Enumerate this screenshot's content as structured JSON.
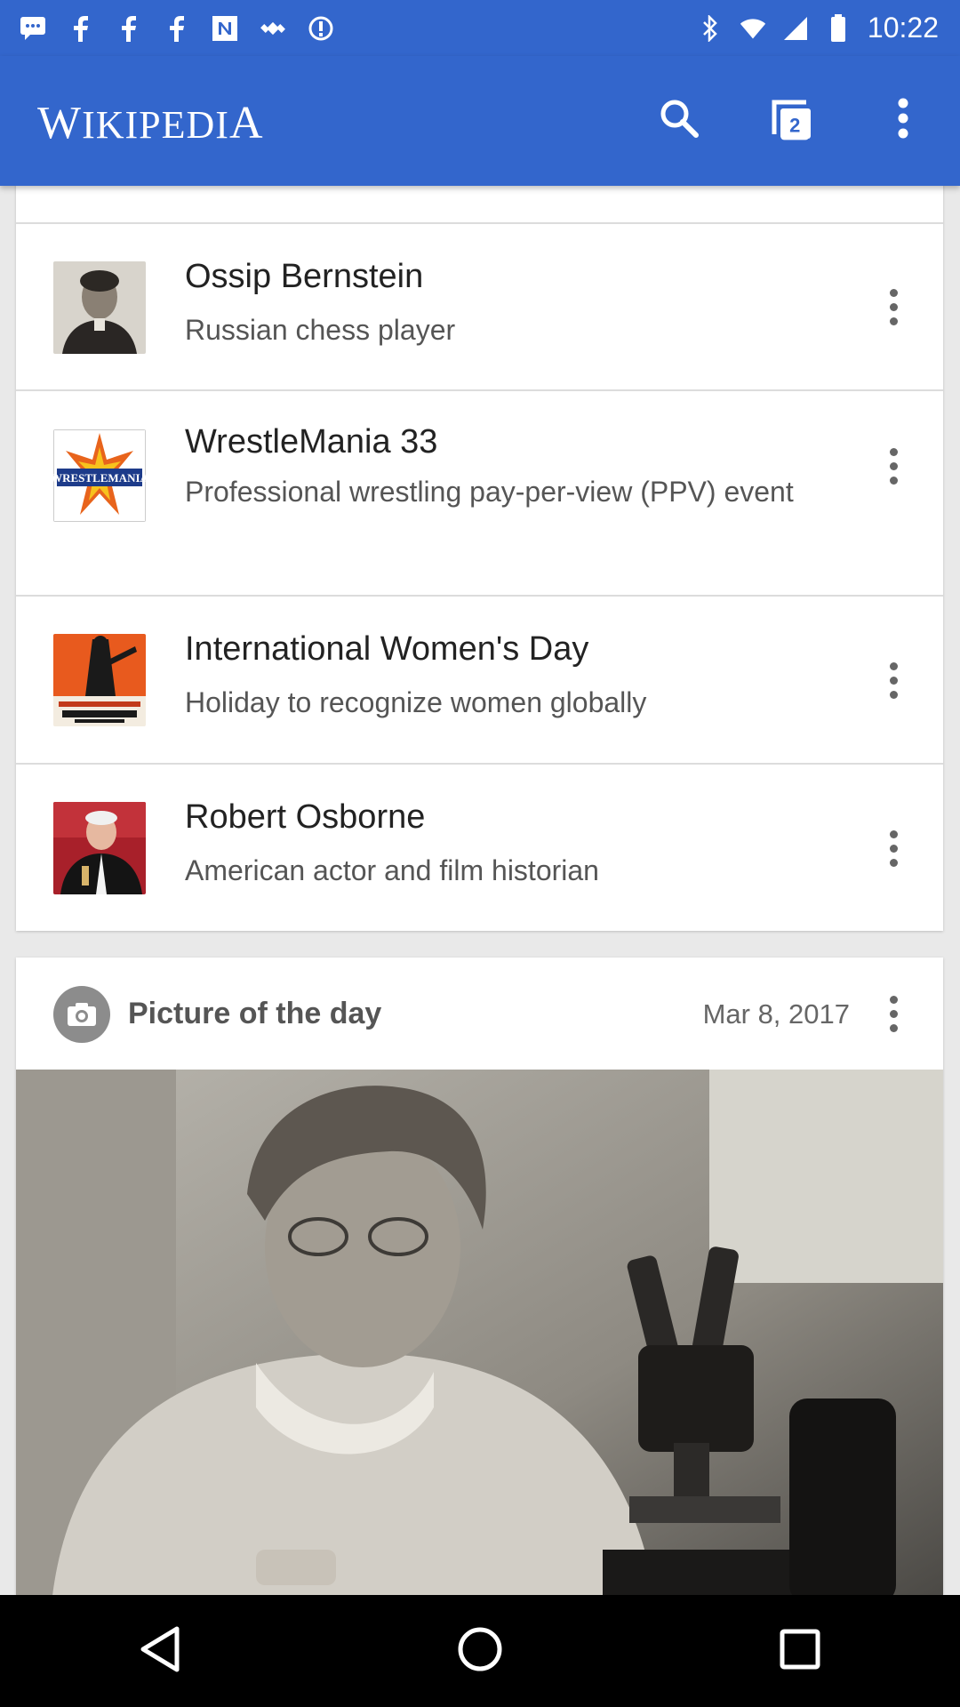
{
  "status_bar": {
    "time": "10:22",
    "icons": [
      "chat-icon",
      "facebook-icon",
      "facebook-icon",
      "facebook-icon",
      "news-icon",
      "gps-icon",
      "data-saver-icon",
      "bluetooth-icon",
      "wifi-icon",
      "cell-signal-icon",
      "battery-icon"
    ]
  },
  "app_bar": {
    "logo_first": "W",
    "logo_middle": "IKIPEDI",
    "logo_last": "A",
    "tab_count": "2",
    "icons": [
      "search-icon",
      "tabs-icon",
      "more-vertical-icon"
    ]
  },
  "feed_list": {
    "items": [
      {
        "title": "Ossip Bernstein",
        "description": "Russian chess player",
        "thumb": "portrait-photo"
      },
      {
        "title": "WrestleMania 33",
        "description": "Professional wrestling pay-per-view (PPV) event",
        "thumb": "wrestlemania-logo"
      },
      {
        "title": "International Women's Day",
        "description": "Holiday to recognize women globally",
        "thumb": "poster"
      },
      {
        "title": "Robert Osborne",
        "description": "American actor and film historian",
        "thumb": "portrait-photo"
      }
    ]
  },
  "picture_of_day": {
    "title": "Picture of the day",
    "date": "Mar 8, 2017",
    "icon": "camera-icon"
  },
  "nav_bar": {
    "icons": [
      "back-icon",
      "home-icon",
      "recents-icon"
    ]
  },
  "colors": {
    "brand_blue": "#3366cc"
  }
}
